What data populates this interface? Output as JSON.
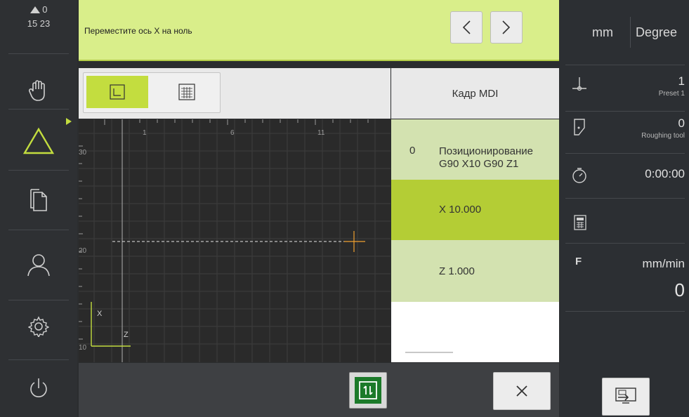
{
  "status": {
    "warnings": "0",
    "time": "15 23"
  },
  "message": {
    "text": "Переместите ось X на ноль"
  },
  "units": {
    "length": "mm",
    "angle": "Degree"
  },
  "preset": {
    "value": "1",
    "label": "Preset 1"
  },
  "tool": {
    "value": "0",
    "label": "Roughing tool"
  },
  "timer": {
    "value": "0:00:00"
  },
  "feed": {
    "letter": "F",
    "unit": "mm/min",
    "value": "0"
  },
  "mdi": {
    "header": "Кадр MDI",
    "block_number": "0",
    "block_title_line1": "Позиционирование",
    "block_title_line2": "G90 X10 G90 Z1",
    "x_value": "X 10.000",
    "z_value": "Z 1.000"
  },
  "graphic": {
    "x_ticks": [
      "1",
      "6",
      "11"
    ],
    "y_ticks": [
      "30",
      "20",
      "10"
    ],
    "axis_x": "X",
    "axis_z": "Z"
  },
  "colors": {
    "accent": "#c3dd3f",
    "message_bg": "#d9ee8a",
    "target_marker": "#f0a030",
    "active_row": "#b4cd35",
    "inactive_row": "#d3e2b0"
  },
  "icons": {
    "nav": [
      "hand-icon",
      "mdi-triangle-icon",
      "files-icon",
      "user-icon",
      "settings-icon",
      "power-icon"
    ],
    "right": [
      "preset-icon",
      "tool-icon",
      "timer-icon",
      "calculator-icon"
    ],
    "bottom": [
      "cycle-start-icon",
      "close-icon",
      "screen-switch-icon"
    ]
  }
}
